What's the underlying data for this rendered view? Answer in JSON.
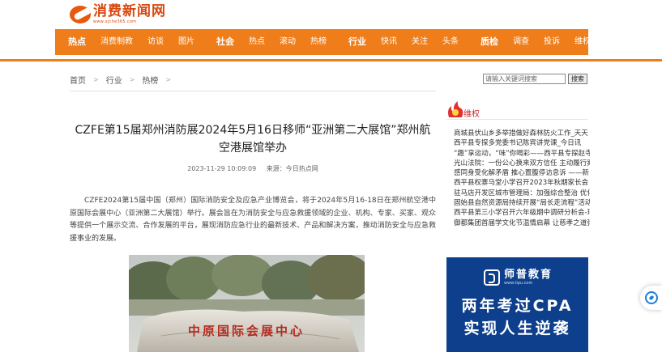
{
  "site": {
    "logo_text": "消费新闻网",
    "logo_url": "www.xjche365.com"
  },
  "nav": {
    "groups": [
      {
        "head": "热点",
        "items": [
          "消费制教",
          "访谈",
          "图片"
        ]
      },
      {
        "head": "社会",
        "items": [
          "热点",
          "滚动",
          "热榜"
        ]
      },
      {
        "head": "行业",
        "items": [
          "快讯",
          "关注",
          "头条"
        ]
      },
      {
        "head": "质检",
        "items": [
          "调查",
          "投诉",
          "维权"
        ]
      }
    ]
  },
  "breadcrumb": [
    "首页",
    "行业",
    "热榜"
  ],
  "search": {
    "placeholder": "请输入关键词搜索",
    "button": "搜索"
  },
  "article": {
    "title": "CZFE第15届郑州消防展2024年5月16日移师“亚洲第二大展馆”郑州航空港展馆举办",
    "date": "2023-11-29 10:09:09",
    "source": "来源：今日热点网",
    "body": "CZFE2024第15届中国（郑州）国际消防安全及应急产业博览会，将于2024年5月16-18日在郑州航空港中原国际会展中心（亚洲第二大展馆）举行。展会旨在为消防安全与应急救援领域的企业、机构、专家、买家、观众等提供一个展示交流、合作发展的平台，展现消防应急行业的最新技术、产品和解决方案，推动消防安全与应急救援事业的发展。",
    "photo_sign": "中原国际会展中心"
  },
  "sidebar": {
    "title": "维权",
    "items": [
      "商城县伏山乡多举措做好森林防火工作_天天",
      "西平县专探多党委书记陈宾讲党课_今日讯",
      "“趣”享运动，“味”你喝彩——西平县专探赵寺小",
      "光山法院：一份公心换来双方信任 主动履行案",
      "感同身受化解矛盾 推心置腹停访息诉 ——新",
      "西平县权寨马堂小学召开2023年秋期家长会",
      "驻马店开发区城市管理局：加强综合整治 优化",
      "固始县自然资源局持续开展“局长走流程”活动",
      "西平县第三小学召开六年级期中调研分析会-环",
      "御都集团首届学文化节温情启幕 让慈孝之道弥"
    ]
  },
  "ad": {
    "brand": "师普教育",
    "url": "www.tipu.com",
    "line1": "两年考过CPA",
    "line2": "实现人生逆袭"
  },
  "colors": {
    "accent": "#ef7d1a",
    "side_red": "#c92a2a",
    "ad_blue": "#0d3f8c"
  }
}
